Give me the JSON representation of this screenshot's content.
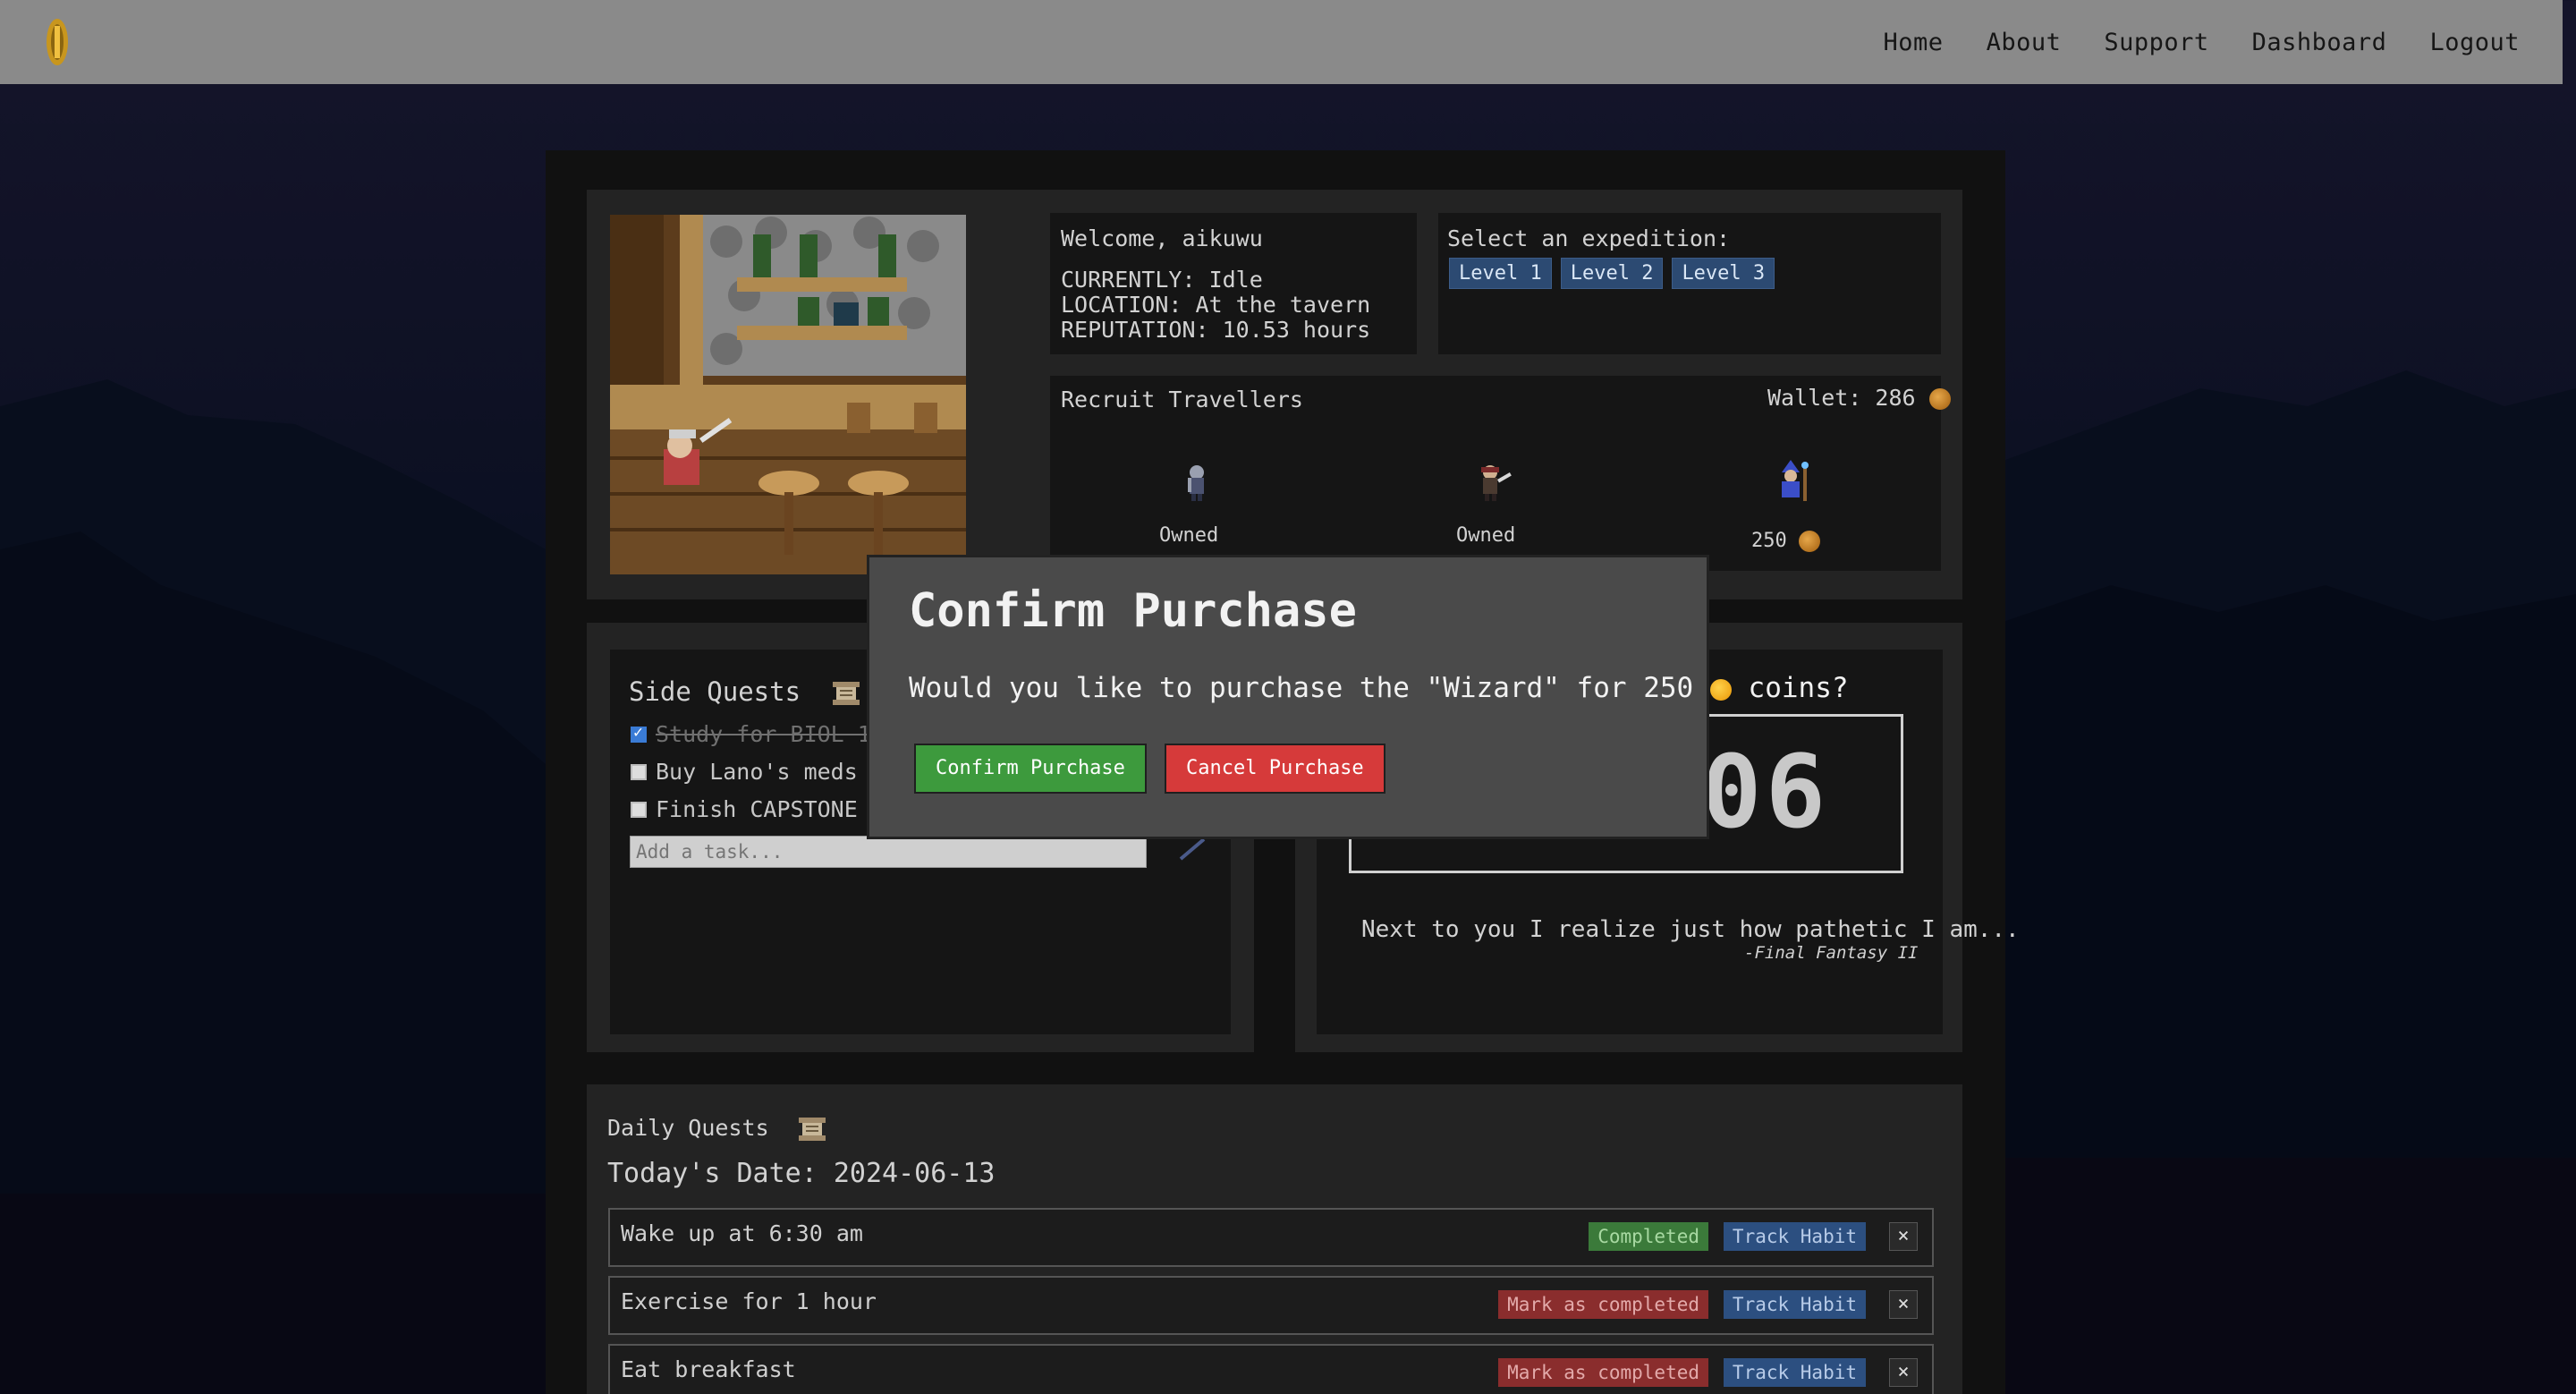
{
  "nav": {
    "links": [
      "Home",
      "About",
      "Support",
      "Dashboard",
      "Logout"
    ]
  },
  "status": {
    "welcome": "Welcome, aikuwu",
    "currently": "CURRENTLY: Idle",
    "location": "LOCATION: At the tavern",
    "reputation": "REPUTATION: 10.53 hours"
  },
  "expedition": {
    "label": "Select an expedition:",
    "levels": [
      "Level 1",
      "Level 2",
      "Level 3"
    ]
  },
  "recruit": {
    "title": "Recruit Travellers",
    "wallet": "Wallet: 286",
    "travellers": [
      {
        "status": "Owned"
      },
      {
        "status": "Owned"
      },
      {
        "status": "250"
      }
    ]
  },
  "side_quests": {
    "title": "Side Quests",
    "tasks": [
      {
        "label": "Study for BIOL 10",
        "done": true
      },
      {
        "label": "Buy Lano's meds f",
        "done": false
      },
      {
        "label": "Finish CAPSTONE F",
        "done": false
      }
    ],
    "input_placeholder": "Add a task..."
  },
  "timer": {
    "digits": "06",
    "quote": "Next to you I realize just how pathetic I am...",
    "quote_source": "-Final Fantasy II"
  },
  "daily_quests": {
    "title": "Daily Quests",
    "date": "Today's Date: 2024-06-13",
    "rows": [
      {
        "label": "Wake up at 6:30 am",
        "status": "Completed",
        "track": "Track Habit",
        "remove": "×"
      },
      {
        "label": "Exercise for 1 hour",
        "status": "Mark as completed",
        "track": "Track Habit",
        "remove": "×"
      },
      {
        "label": "Eat breakfast",
        "status": "Mark as completed",
        "track": "Track Habit",
        "remove": "×"
      }
    ]
  },
  "modal": {
    "title": "Confirm Purchase",
    "text_before": "Would you like to purchase the \"Wizard\" for 250",
    "text_after": "coins?",
    "confirm": "Confirm Purchase",
    "cancel": "Cancel Purchase"
  },
  "colors": {
    "completed": "#3b7a3a",
    "mark": "#8a2d2d",
    "track": "#2c4f80",
    "confirm": "#3d9a3d",
    "cancel": "#d63a3a"
  }
}
